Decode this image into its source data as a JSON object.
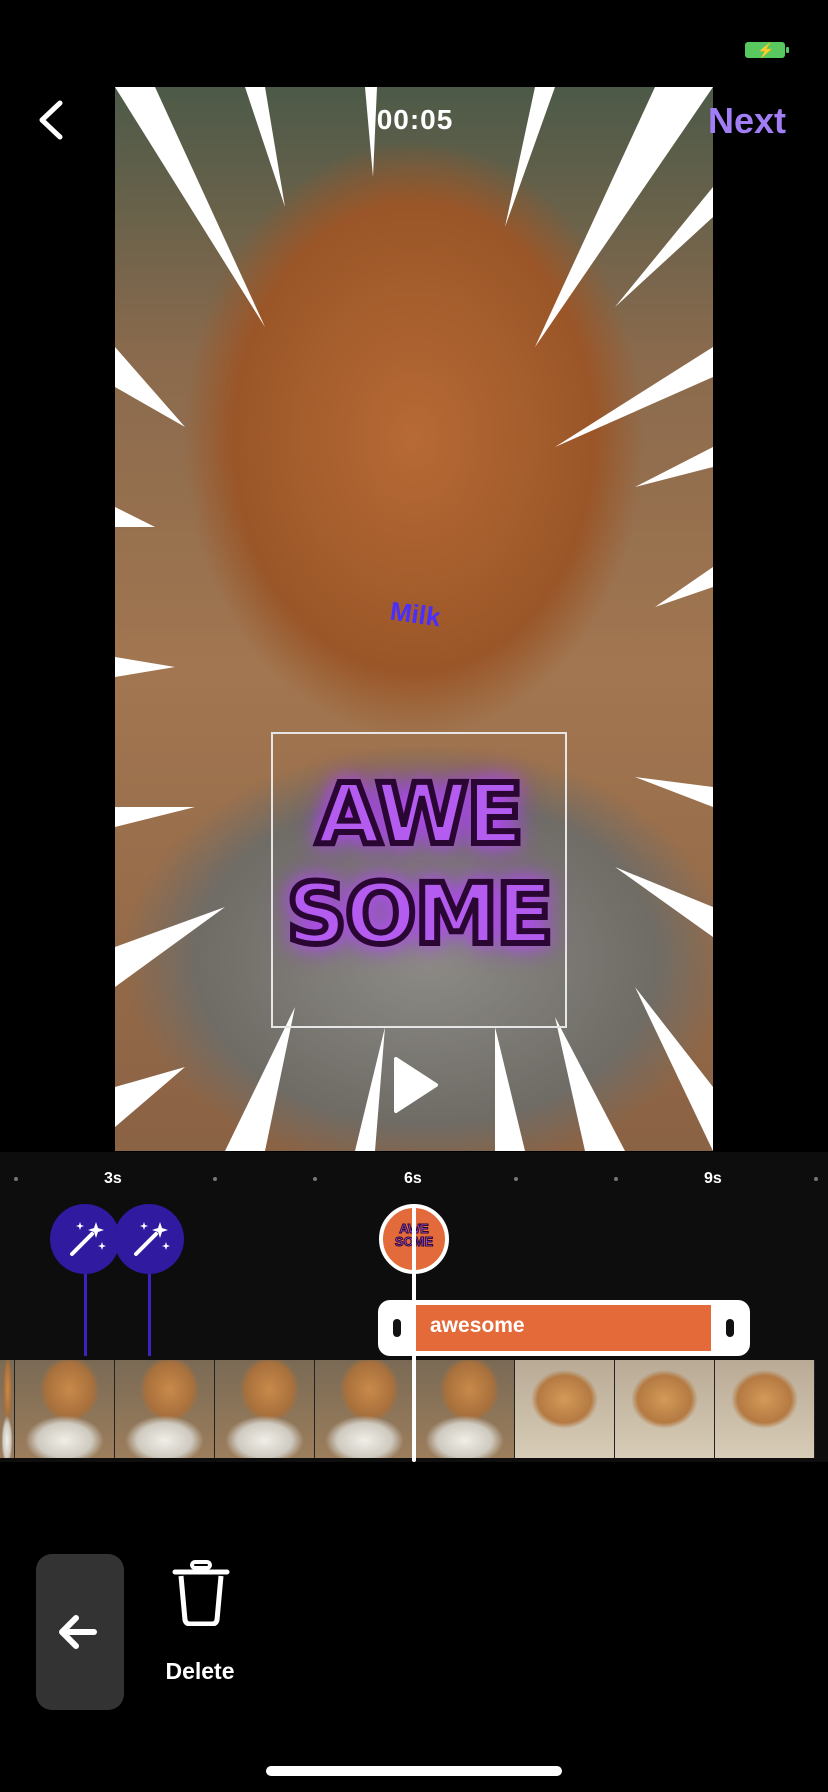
{
  "status": {
    "battery_color": "#58c85f"
  },
  "header": {
    "timecode": "00:05",
    "next_label": "Next",
    "back_icon": "chevron-left-icon",
    "next_color": "#a27ef6"
  },
  "video": {
    "stickers": {
      "awesome_text": "AWE SOME",
      "milk_text": "Milk"
    },
    "play_icon": "play-icon"
  },
  "timeline": {
    "ruler": [
      "3s",
      "6s",
      "9s"
    ],
    "effects": [
      {
        "icon": "magic-wand-icon"
      },
      {
        "icon": "magic-wand-icon"
      }
    ],
    "sticker_marker": "AWE SOME",
    "clip": {
      "label": "awesome",
      "color": "#e46a3a"
    }
  },
  "tools": {
    "undo_icon": "arrow-left-icon",
    "delete_label": "Delete",
    "delete_icon": "trash-icon"
  }
}
